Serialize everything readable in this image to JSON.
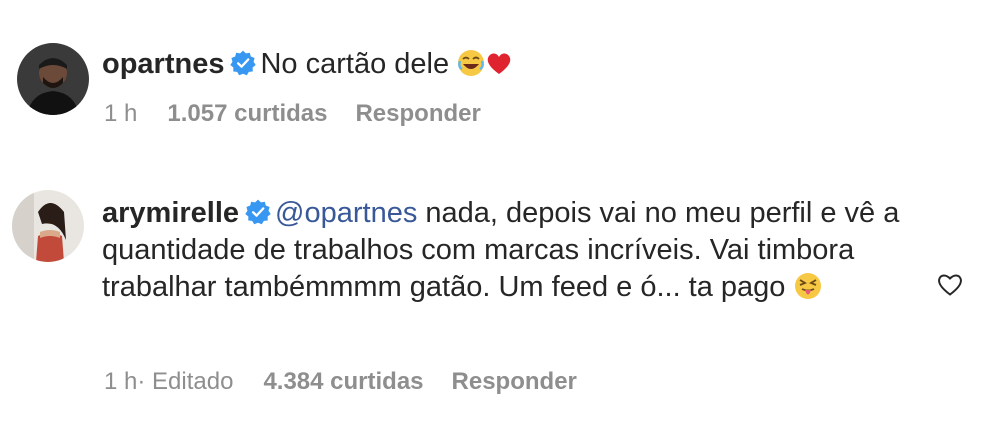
{
  "comments": [
    {
      "username": "opartnes",
      "verified": true,
      "text": "No cartão dele",
      "emojis": [
        "laughing-face-icon",
        "red-heart-icon"
      ],
      "time": "1 h",
      "likes": "1.057 curtidas",
      "reply_label": "Responder"
    },
    {
      "username": "arymirelle",
      "verified": true,
      "mention": "@opartnes",
      "text": " nada, depois vai no meu perfil e vê a quantidade de trabalhos com marcas incríveis. Vai timbora trabalhar tambémmmm gatão. Um feed e ó... ta pago",
      "emojis": [
        "squinting-tongue-face-icon"
      ],
      "time": "1 h·",
      "edited": "Editado",
      "likes": "4.384 curtidas",
      "reply_label": "Responder"
    }
  ],
  "colors": {
    "text": "#262626",
    "muted": "#8e8e8e",
    "mention": "#385898",
    "verified": "#3897f0"
  }
}
